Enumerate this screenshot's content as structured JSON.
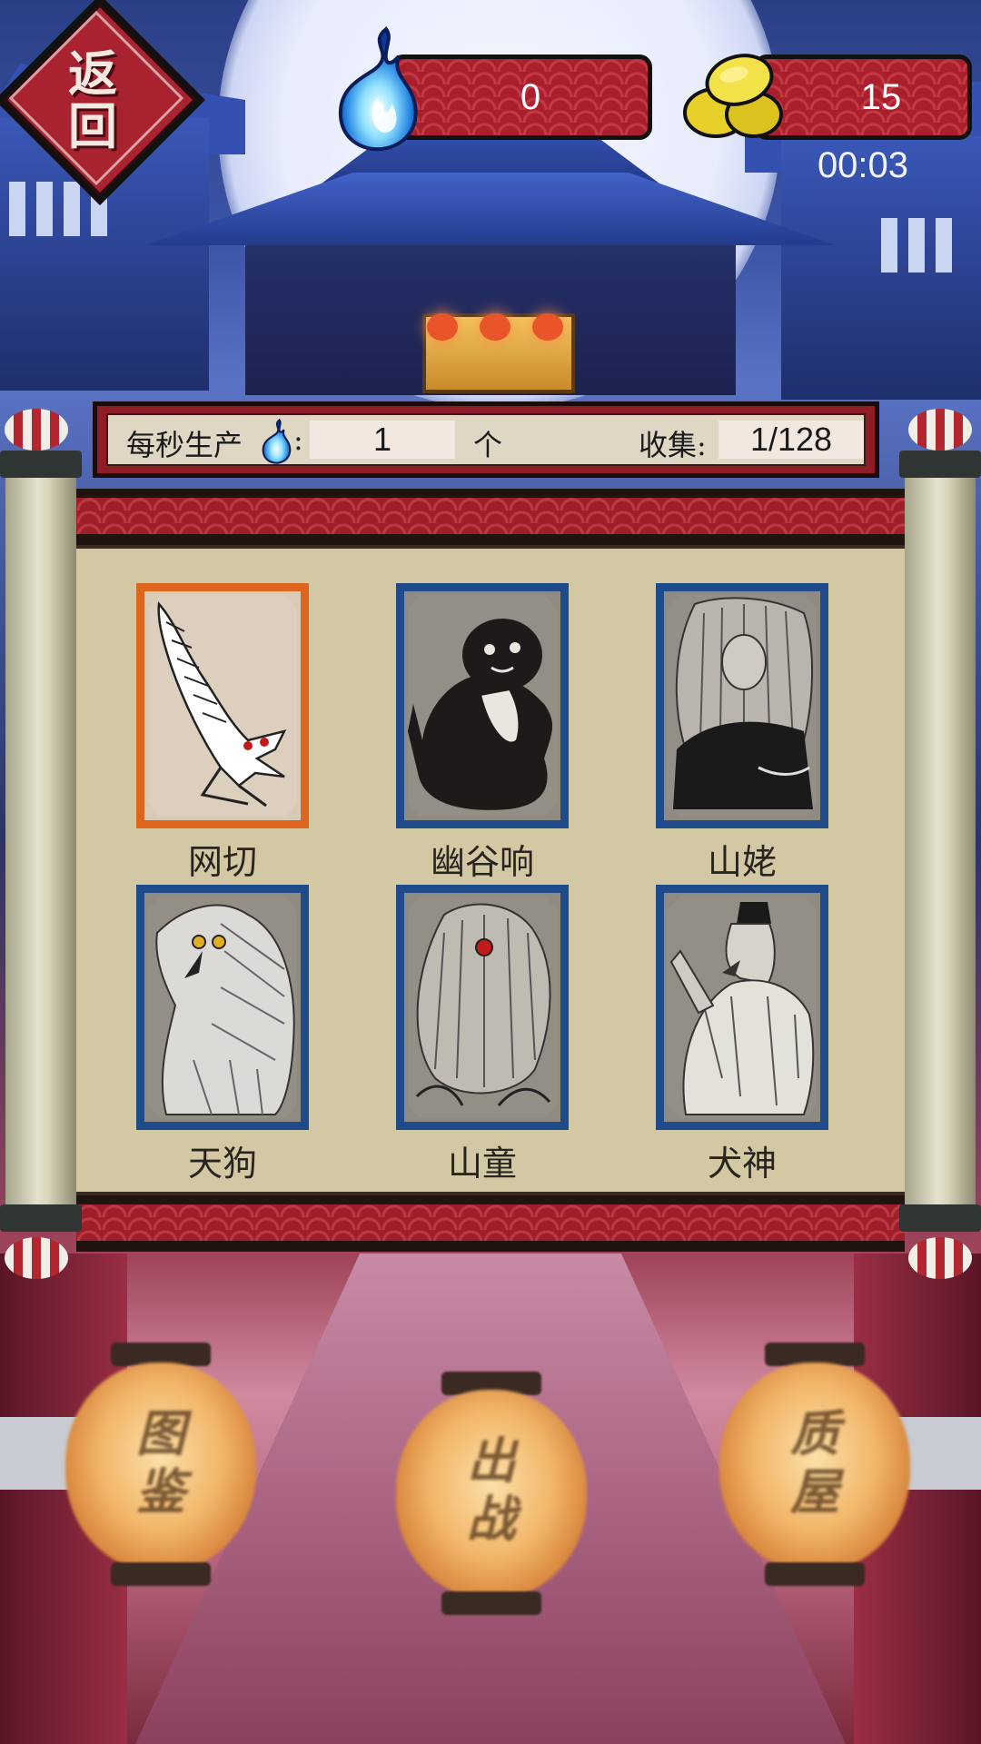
{
  "hud": {
    "back_label": "返\n回",
    "soul_value": "0",
    "coin_value": "15",
    "timer": "00:03",
    "icons": {
      "back": "back-diamond-icon",
      "soul": "blue-soul-flame-icon",
      "coin": "gold-coins-icon"
    }
  },
  "info": {
    "production_label": "每秒生产",
    "colon": ":",
    "production_value": "1",
    "unit": "个",
    "collect_label": "收集:",
    "collect_value": "1/128"
  },
  "cards": [
    {
      "name": "网切",
      "selected": true,
      "icon": "amikiri-yokai-icon"
    },
    {
      "name": "幽谷响",
      "selected": false,
      "icon": "yamabiko-yokai-icon"
    },
    {
      "name": "山姥",
      "selected": false,
      "icon": "yamauba-yokai-icon"
    },
    {
      "name": "天狗",
      "selected": false,
      "icon": "tengu-yokai-icon"
    },
    {
      "name": "山童",
      "selected": false,
      "icon": "yamawaro-yokai-icon"
    },
    {
      "name": "犬神",
      "selected": false,
      "icon": "inugami-yokai-icon"
    }
  ],
  "menu": [
    {
      "label": "图\n鉴"
    },
    {
      "label": "出\n战"
    },
    {
      "label": "质\n屋"
    }
  ],
  "colors": {
    "selected_border": "#e0651c",
    "card_border": "#1f4b8a",
    "bar_red": "#a9202c",
    "scroll_paper": "#d3c8a4"
  }
}
